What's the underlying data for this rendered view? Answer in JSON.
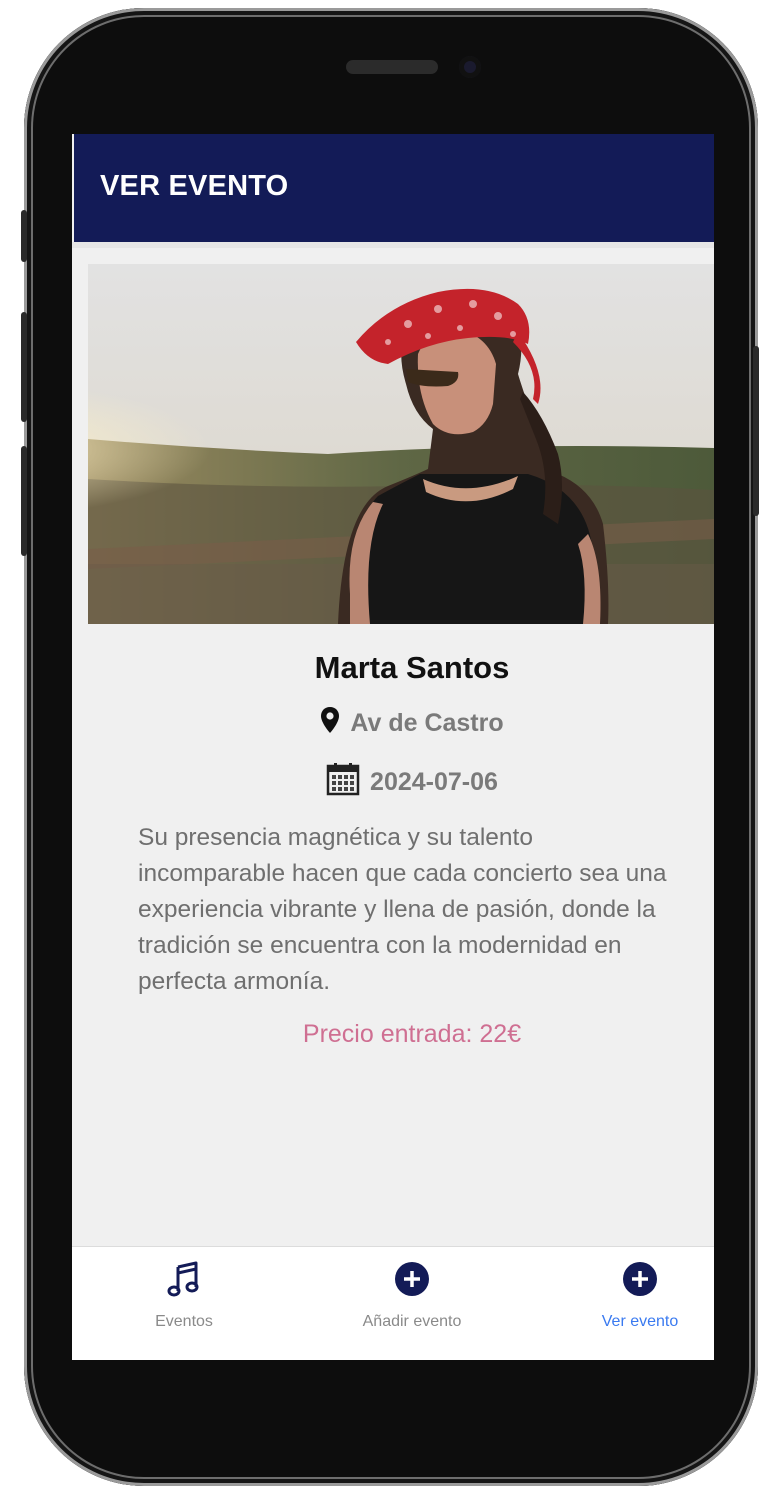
{
  "header": {
    "title": "VER EVENTO"
  },
  "event": {
    "image_icon": "event-photo",
    "name": "Marta Santos",
    "location": "Av de Castro",
    "date": "2024-07-06",
    "description": " Su presencia magnética y su talento incomparable hacen que cada concierto sea una experiencia vibrante y llena de pasión, donde la tradición se encuentra con la modernidad en perfecta armonía.",
    "price": "Precio entrada: 22€"
  },
  "tabs": [
    {
      "label": "Eventos",
      "icon": "music-note-icon",
      "active": false
    },
    {
      "label": "Añadir evento",
      "icon": "plus-circle-icon",
      "active": false
    },
    {
      "label": "Ver evento",
      "icon": "plus-circle-icon",
      "active": true
    }
  ],
  "colors": {
    "header_bg": "#131b57",
    "price": "#cf6f92",
    "active_tab": "#3a7af0",
    "icon_fill": "#131b57"
  }
}
